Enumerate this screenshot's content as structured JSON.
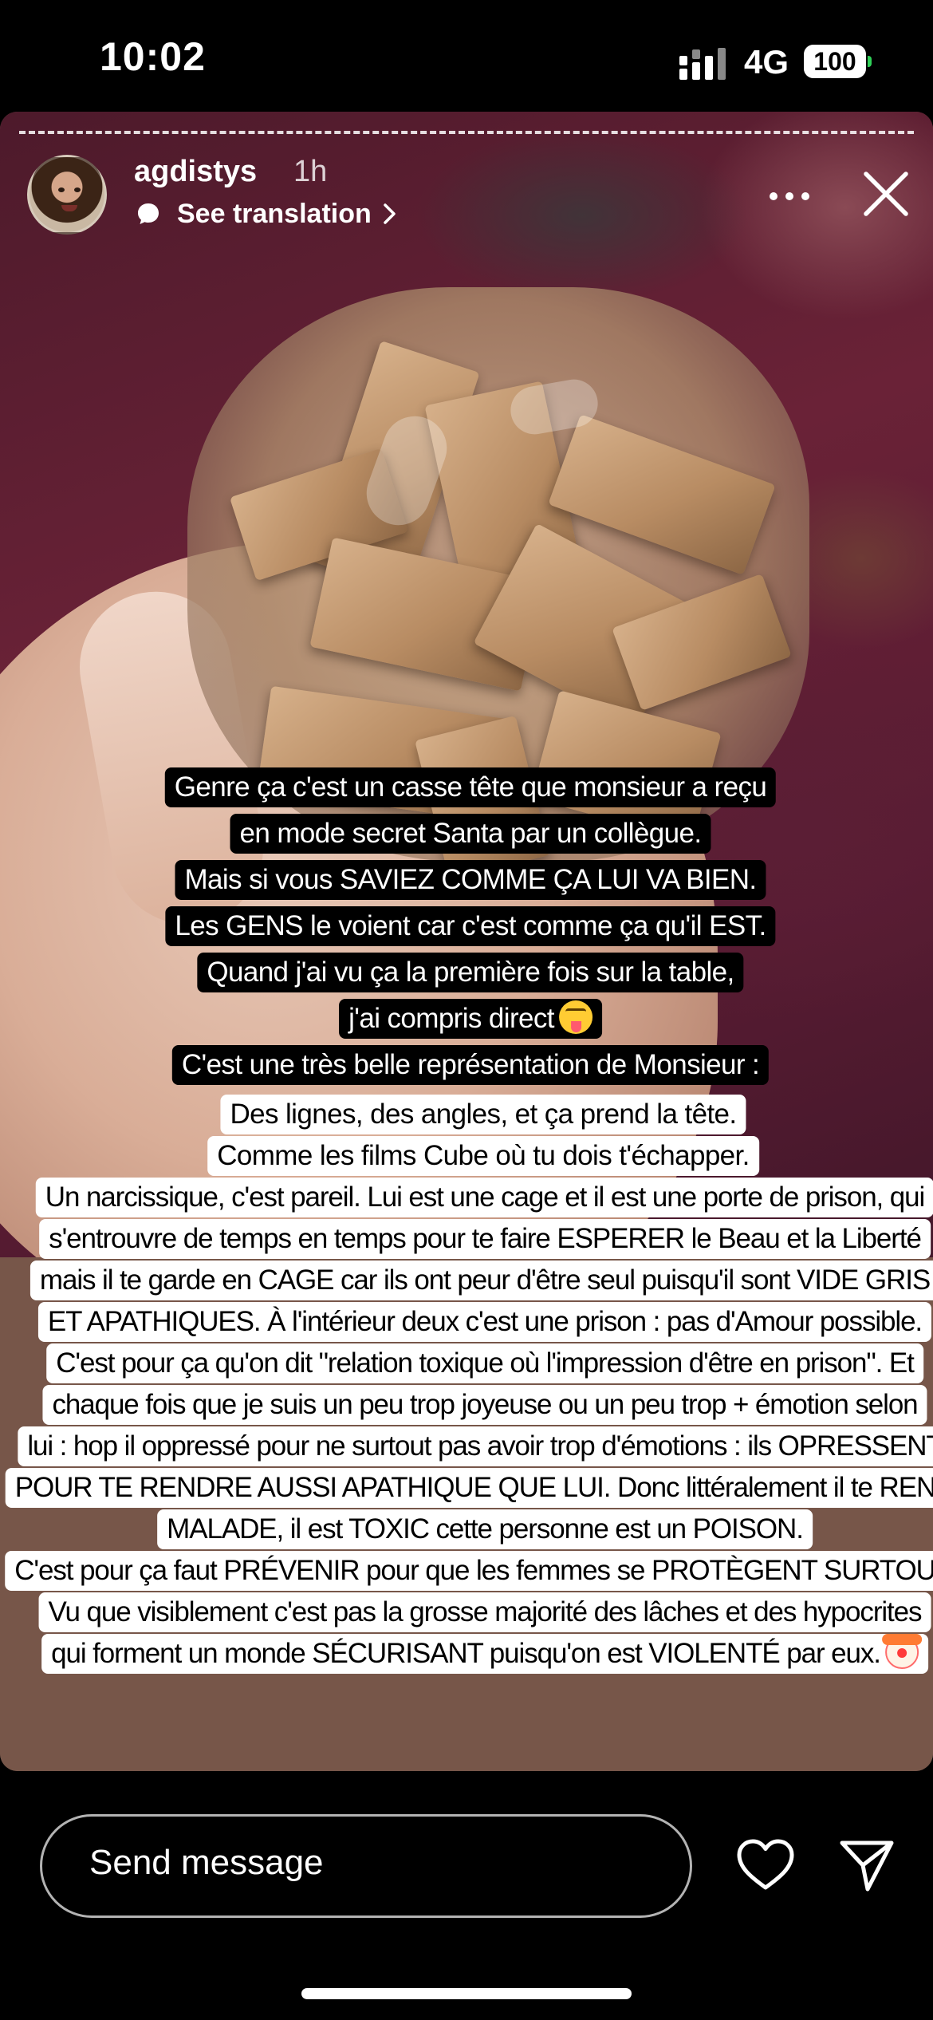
{
  "status_bar": {
    "time": "10:02",
    "network": "4G",
    "battery": "100"
  },
  "story": {
    "username": "agdistys",
    "time_ago": "1h",
    "translate_label": "See translation",
    "caption_black": [
      "Genre ça c'est un casse tête que monsieur a reçu",
      "en mode secret Santa par un collègue.",
      "Mais si vous SAVIEZ COMME ÇA LUI VA BIEN.",
      "Les GENS le voient car c'est comme ça qu'il EST.",
      "Quand j'ai vu ça la première fois sur la table,",
      "j'ai compris direct",
      "C'est une très belle représentation de Monsieur :"
    ],
    "caption_white": [
      "Des lignes, des angles, et ça prend la tête.",
      "Comme les films Cube où tu dois t'échapper.",
      "Un narcissique, c'est pareil. Lui est une cage et il est une porte de prison, qui",
      "s'entrouvre de temps en temps pour te faire ESPERER le Beau et la Liberté",
      "mais il te garde en CAGE  car ils ont peur d'être seul puisqu'il sont VIDE GRIS",
      "ET APATHIQUES. À l'intérieur deux c'est une prison : pas d'Amour possible.",
      "C'est pour ça qu'on dit \"relation toxique où l'impression d'être en prison\". Et",
      "chaque fois que je suis un peu trop joyeuse ou un peu trop + émotion selon",
      "lui : hop il oppressé pour ne surtout pas avoir trop d'émotions : ils OPRESSENT",
      "POUR TE RENDRE AUSSI APATHIQUE QUE LUI. Donc littéralement il te REND",
      "MALADE, il est TOXIC cette personne est un POISON.",
      "C'est pour ça faut PRÉVENIR  pour que les femmes se PROTÈGENT SURTOUT.",
      "Vu que visiblement c'est pas la grosse majorité des lâches et des hypocrites",
      "qui forment un monde SÉCURISANT puisqu'on est VIOLENTÉ par eux."
    ]
  },
  "bottom_bar": {
    "message_placeholder": "Send message"
  },
  "icons": {
    "signal": "cellular-signal-icon",
    "translate": "speech-bubble-icon",
    "more": "more-dots-icon",
    "close": "close-icon",
    "like": "heart-icon",
    "share": "send-icon"
  },
  "colors": {
    "caption_black_bg": "#000000",
    "caption_white_bg": "#ffffff",
    "story_bottom_bg": "#775649",
    "battery_tip": "#30d158"
  }
}
